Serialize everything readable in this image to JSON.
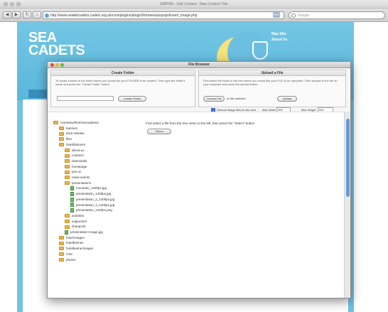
{
  "browser": {
    "title": "EMPIRE - Edit Content - New Content Title",
    "url": "http://www.seadetcadets.cadets.org.uk/cms/plugins/plugin/htmlarea/popups/insert_image.php",
    "search_placeholder": "Google",
    "rss": "RSS",
    "back": "◀",
    "forward": "▶",
    "reload": "↻",
    "home": "⌂"
  },
  "site": {
    "logo": "SEA CADETS",
    "header_links": [
      "Map Site",
      "About Us"
    ]
  },
  "modal": {
    "title": "File Browser",
    "create_folder": {
      "heading": "Create Folder",
      "description": "To create a folder in the folder where you would like your FOLDER to be created. Then type the folder's name and press the \"Create Folder\" button.",
      "button": "Create Folder"
    },
    "upload": {
      "heading": "Upload a File",
      "description": "First select the folder in the tree where you would like your FILE to be uploaded. Then browse to the file on your computer and press the upload button.",
      "choose_button": "Choose File",
      "no_file": "no file selected",
      "upload_button": "Upload",
      "resize_label": "Reduce image files for the web",
      "max_width_label": "Max Width",
      "max_width_value": "500",
      "max_height_label": "Max Height",
      "max_height_value": "500"
    },
    "instruction": "First select a file from the tree menu to the left, then press the \"Select\" button",
    "select_button": "Select",
    "tree": [
      {
        "label": "/var/www/html/seacadets/a",
        "type": "root",
        "level": 0
      },
      {
        "label": "banners",
        "type": "folder",
        "level": 1
      },
      {
        "label": "dock-release",
        "type": "folder",
        "level": 1
      },
      {
        "label": "files",
        "type": "folder",
        "level": 1
      },
      {
        "label": "hotel/banners",
        "type": "folder",
        "level": 1
      },
      {
        "label": "about-us",
        "type": "folder",
        "level": 2
      },
      {
        "label": "contacts",
        "type": "folder",
        "level": 2
      },
      {
        "label": "downloads",
        "type": "folder",
        "level": 2
      },
      {
        "label": "homepage",
        "type": "folder",
        "level": 2
      },
      {
        "label": "join-us",
        "type": "folder",
        "level": 2
      },
      {
        "label": "news-events",
        "type": "folder",
        "level": 2
      },
      {
        "label": "presentations",
        "type": "folder",
        "level": 2
      },
      {
        "label": "mountain_1400px.jpg",
        "type": "file",
        "level": 3
      },
      {
        "label": "presentation_1400px.jpg",
        "type": "file",
        "level": 3
      },
      {
        "label": "presentation_2_1400px.jpg",
        "type": "file",
        "level": 3
      },
      {
        "label": "presentation_3_1400px.jpg",
        "type": "file",
        "level": 3
      },
      {
        "label": "presentation_1400px.png",
        "type": "file",
        "level": 3
      },
      {
        "label": "activities",
        "type": "folder",
        "level": 2
      },
      {
        "label": "supporters",
        "type": "folder",
        "level": 2
      },
      {
        "label": "shanpoint",
        "type": "folder",
        "level": 2
      },
      {
        "label": "presentation-image.jpg",
        "type": "file",
        "level": 2
      },
      {
        "label": "hotel-images",
        "type": "folder",
        "level": 1
      },
      {
        "label": "hotelbannes",
        "type": "folder",
        "level": 1
      },
      {
        "label": "hotelbannerimages",
        "type": "folder",
        "level": 1
      },
      {
        "label": "misc",
        "type": "folder",
        "level": 1
      },
      {
        "label": "photos",
        "type": "folder",
        "level": 1
      }
    ]
  },
  "colors": {
    "site_blue": "#6fc3e2",
    "moon": "#f4e27a",
    "folder": "#e8b84c",
    "file": "#6fbf6a",
    "scroll_thumb": "#6a9bd8"
  }
}
